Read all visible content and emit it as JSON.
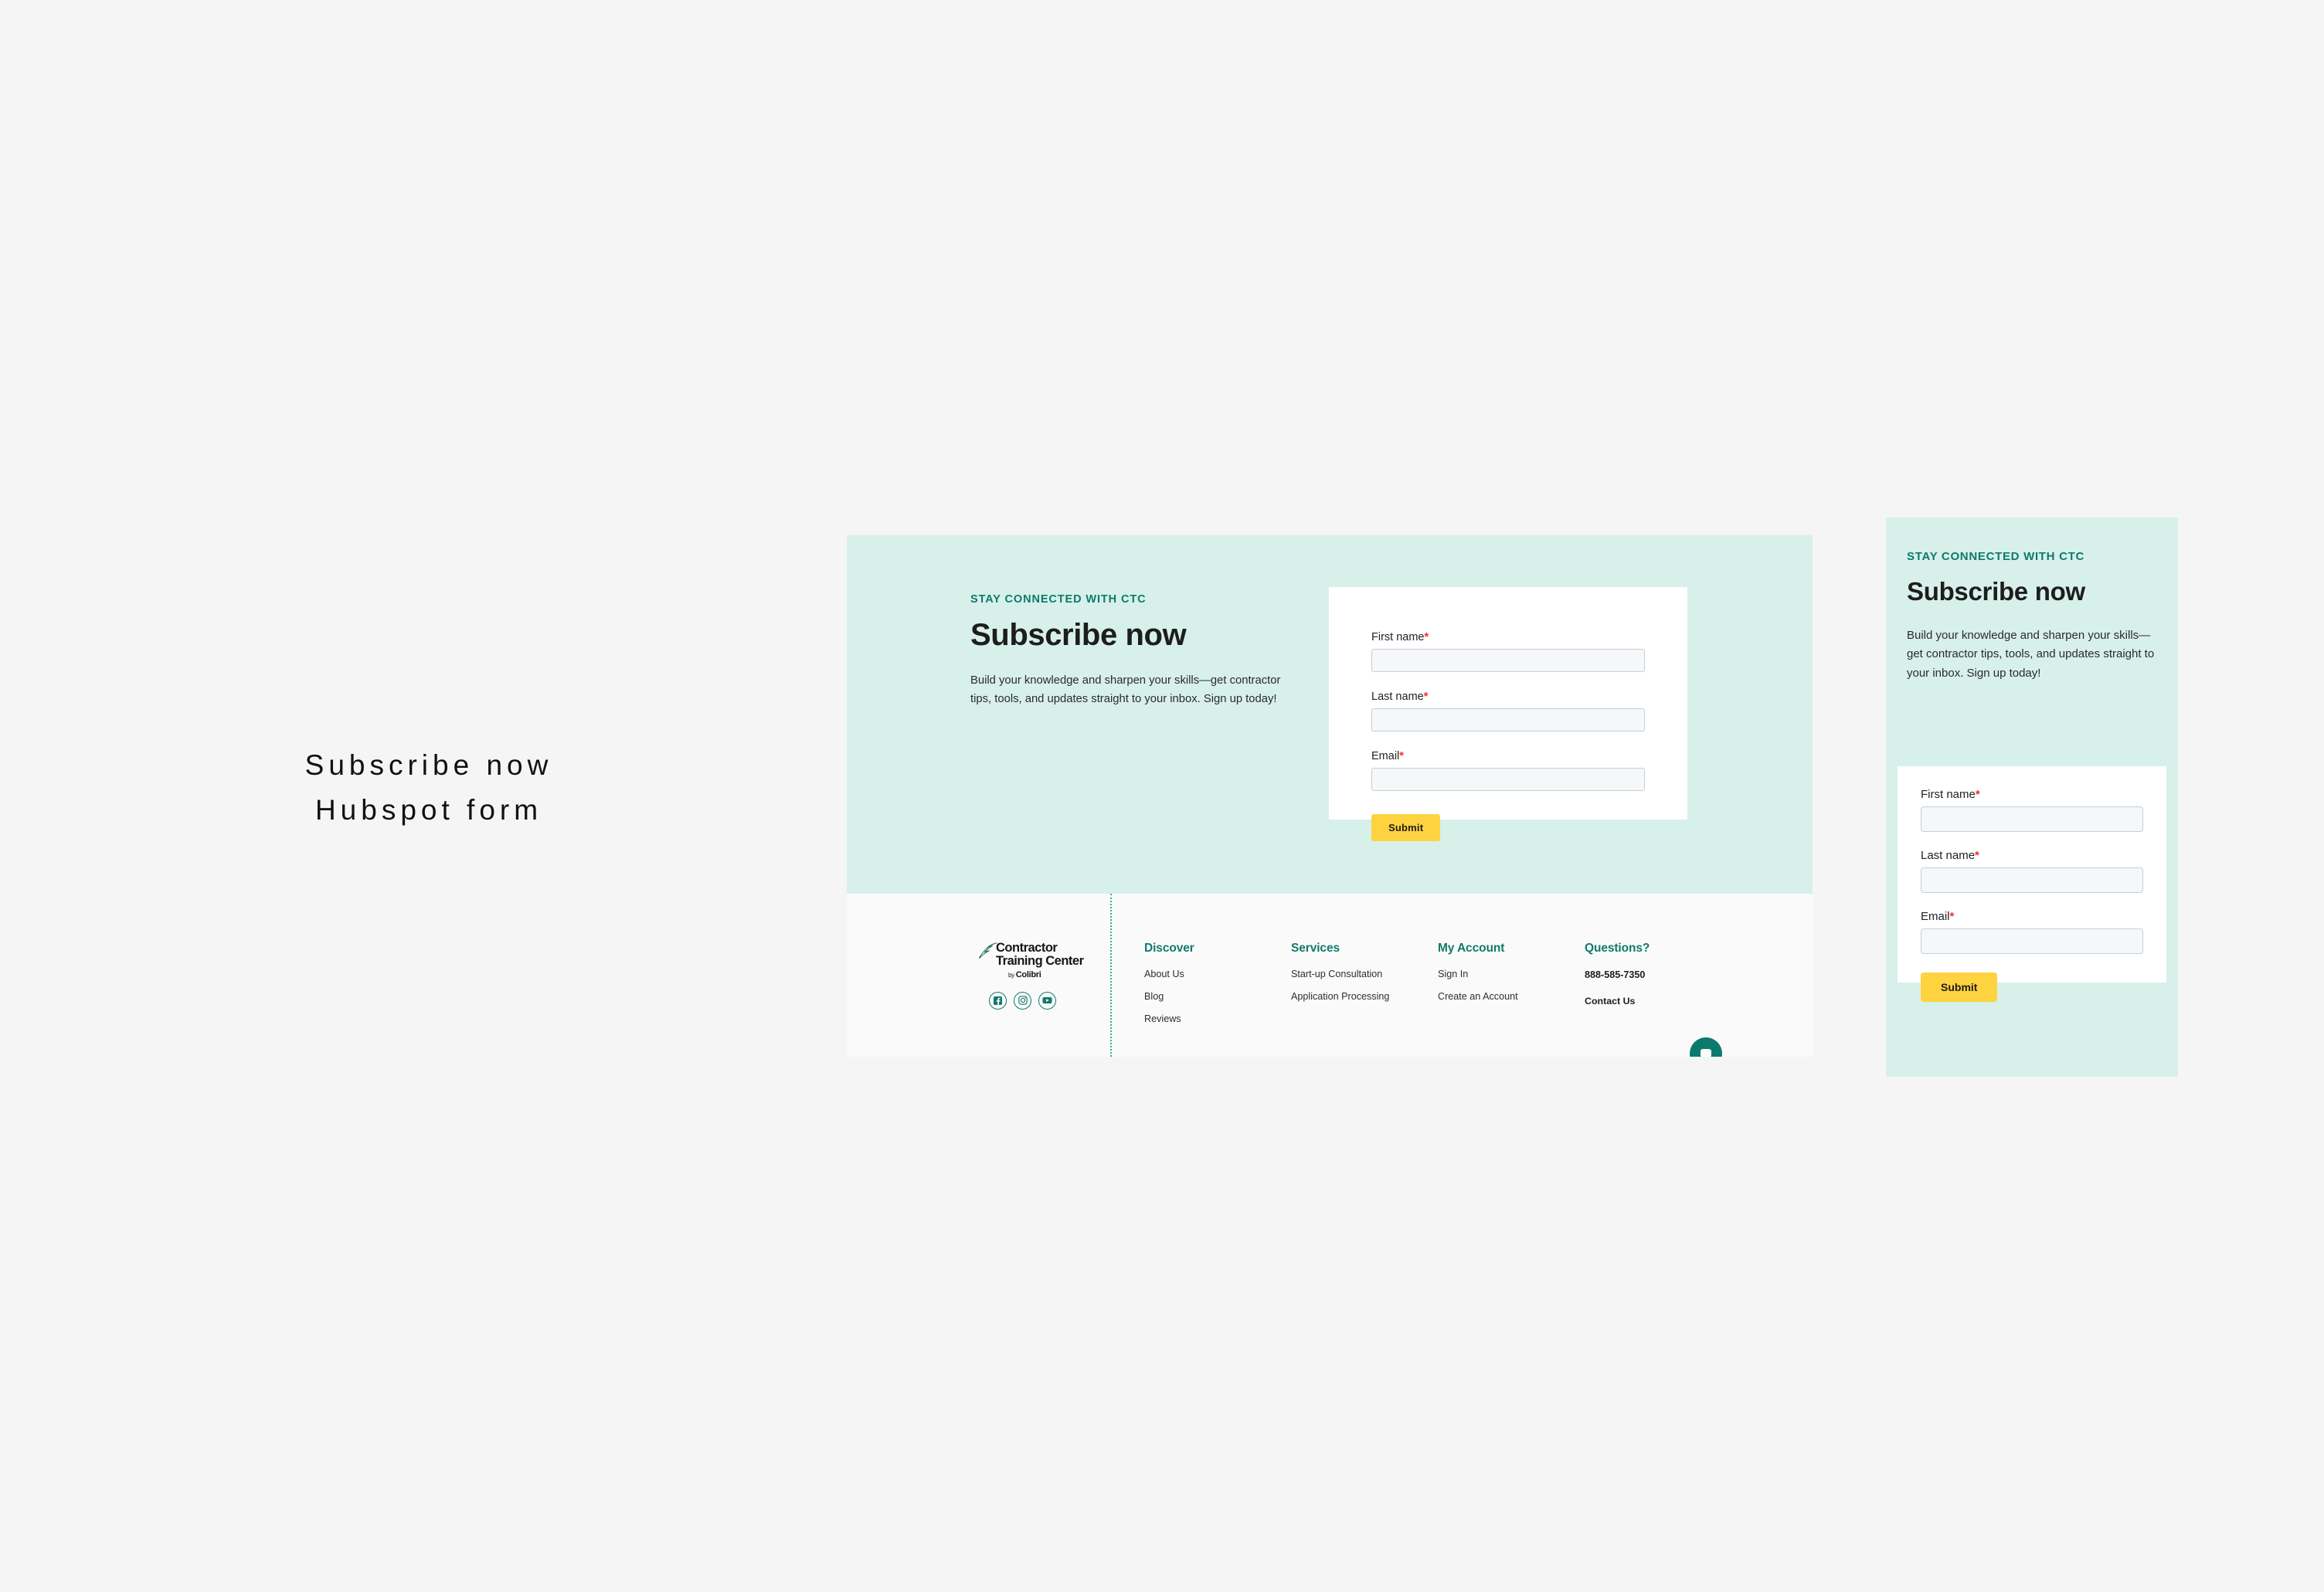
{
  "annotation": {
    "line1": "Subscribe now",
    "line2": "Hubspot form"
  },
  "colors": {
    "page_background": "#f5f5f5",
    "mint_background": "#d7f0ea",
    "teal_accent": "#117a6c",
    "yellow_button": "#ffd23f",
    "required_red": "#f02d2d",
    "footer_background": "#fafafa"
  },
  "desktop": {
    "hero": {
      "eyebrow": "STAY CONNECTED WITH CTC",
      "title": "Subscribe now",
      "subtitle": "Build your knowledge and sharpen your skills—get contractor tips, tools, and updates straight to your inbox. Sign up today!"
    },
    "form": {
      "fields": [
        {
          "label": "First name",
          "required": "*",
          "value": "",
          "placeholder": ""
        },
        {
          "label": "Last name",
          "required": "*",
          "value": "",
          "placeholder": ""
        },
        {
          "label": "Email",
          "required": "*",
          "value": "",
          "placeholder": ""
        }
      ],
      "submit_label": "Submit"
    },
    "footer": {
      "brand": {
        "line1": "Contractor",
        "line2": "Training Center",
        "byline_prefix": "by ",
        "byline": "Colibri"
      },
      "socials": [
        {
          "name": "facebook-icon"
        },
        {
          "name": "instagram-icon"
        },
        {
          "name": "youtube-icon"
        }
      ],
      "columns": [
        {
          "title": "Discover",
          "links": [
            "About Us",
            "Blog",
            "Reviews"
          ]
        },
        {
          "title": "Services",
          "links": [
            "Start-up Consultation",
            "Application Processing"
          ]
        },
        {
          "title": "My Account",
          "links": [
            "Sign In",
            "Create an Account"
          ]
        },
        {
          "title": "Questions?",
          "phone": "888-585-7350",
          "contact": "Contact Us"
        }
      ]
    }
  },
  "mobile": {
    "hero": {
      "eyebrow": "STAY CONNECTED WITH CTC",
      "title": "Subscribe now",
      "subtitle": "Build your knowledge and sharpen your skills—get contractor tips, tools, and updates straight to your inbox. Sign up today!"
    },
    "form": {
      "fields": [
        {
          "label": "First name",
          "required": "*",
          "value": "",
          "placeholder": ""
        },
        {
          "label": "Last name",
          "required": "*",
          "value": "",
          "placeholder": ""
        },
        {
          "label": "Email",
          "required": "*",
          "value": "",
          "placeholder": ""
        }
      ],
      "submit_label": "Submit"
    }
  }
}
